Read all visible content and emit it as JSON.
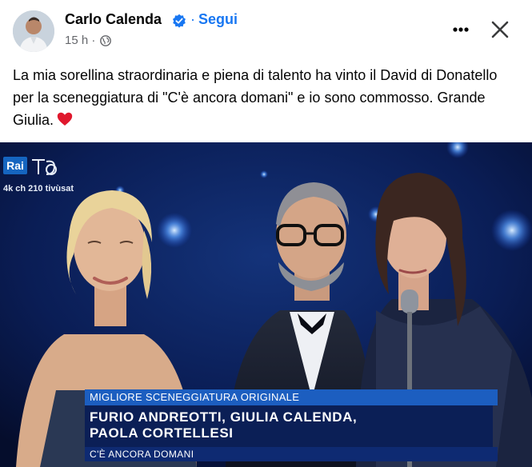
{
  "post": {
    "author": "Carlo Calenda",
    "follow_label": "Segui",
    "separator": "·",
    "timestamp": "15 h ·",
    "caption": "La mia sorellina straordinaria e piena di talento ha vinto il David di Donatello per la sceneggiatura di \"C'è ancora domani\" e io sono commosso. Grande Giulia.",
    "icons": [
      "verified-badge-icon",
      "globe-icon",
      "more-options-icon",
      "close-icon",
      "heart-emoji-icon"
    ]
  },
  "broadcast": {
    "channel_logo": "Rai",
    "channel_info": "4k ch 210 tivùsat",
    "award_category": "MIGLIORE SCENEGGIATURA ORIGINALE",
    "winners_line1": "FURIO ANDREOTTI, GIULIA CALENDA,",
    "winners_line2": "PAOLA CORTELLESI",
    "film_title": "C'È ANCORA DOMANI"
  },
  "colors": {
    "link": "#1877f2",
    "secondary_text": "#65676b",
    "tv_banner_top": "#1c5ec0",
    "tv_banner_main": "#0b1f56"
  }
}
